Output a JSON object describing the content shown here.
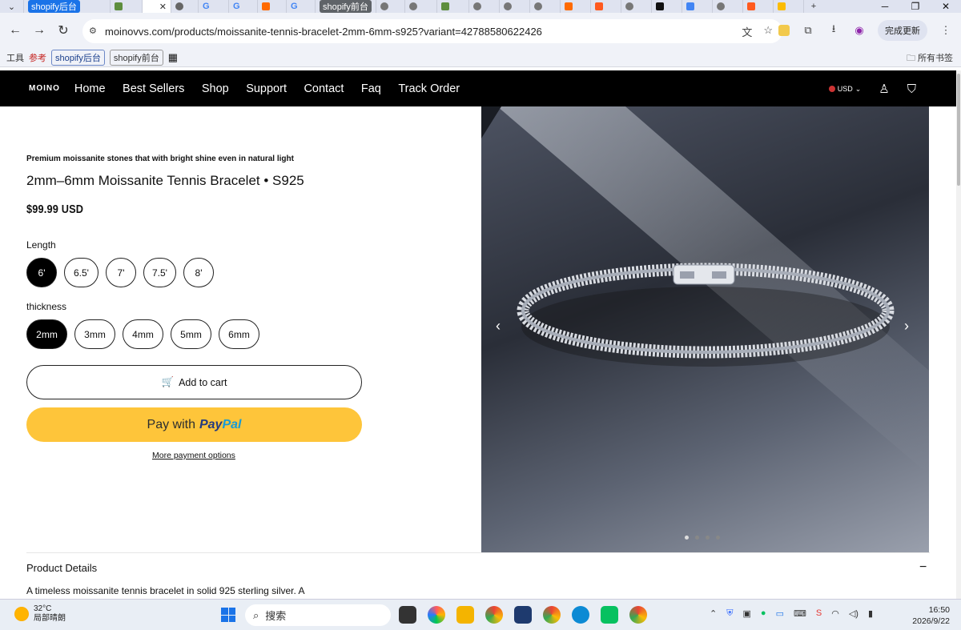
{
  "browser": {
    "tabs": [
      {
        "label": "",
        "kind": "dropdown"
      },
      {
        "label": "shopify后台",
        "kind": "pill"
      },
      {
        "label": "S",
        "kind": "fav"
      },
      {
        "label": "",
        "kind": "active"
      },
      {
        "label": "G",
        "kind": "fav"
      },
      {
        "label": "G",
        "kind": "fav"
      },
      {
        "label": "",
        "kind": "fav"
      },
      {
        "label": "G",
        "kind": "fav"
      },
      {
        "label": "shopify前台",
        "kind": "pill2"
      }
    ],
    "new_tab": "+",
    "url": "moinovvs.com/products/moissanite-tennis-bracelet-2mm-6mm-s925?variant=42788580622426",
    "update_label": "完成更新",
    "bookmarks": {
      "item1": "工具",
      "item2": "参考",
      "item3": "shopify后台",
      "item4": "shopify前台",
      "all": "所有书签"
    }
  },
  "site": {
    "logo": "MOINO",
    "nav": [
      "Home",
      "Best Sellers",
      "Shop",
      "Support",
      "Contact",
      "Faq",
      "Track Order"
    ],
    "currency": "USD"
  },
  "product": {
    "tagline": "Premium moissanite stones that with bright shine even in natural light",
    "title": "2mm–6mm Moissanite Tennis Bracelet • S925",
    "price": "$99.99 USD",
    "length_label": "Length",
    "lengths": [
      "6'",
      "6.5'",
      "7'",
      "7.5'",
      "8'"
    ],
    "length_selected": "6'",
    "thickness_label": "thickness",
    "thicknesses": [
      "2mm",
      "3mm",
      "4mm",
      "5mm",
      "6mm"
    ],
    "thickness_selected": "2mm",
    "add_to_cart": "Add to cart",
    "paypal_prefix": "Pay with",
    "paypal_brand_1": "Pay",
    "paypal_brand_2": "Pal",
    "more_payment": "More payment options",
    "details_heading": "Product Details",
    "details_text": "A timeless moissanite tennis bracelet in solid 925 sterling silver. A",
    "gallery_dots": 4,
    "gallery_active": 0
  },
  "taskbar": {
    "temp": "32°C",
    "weather": "局部晴朗",
    "search": "搜索",
    "time": "16:50",
    "date": "2026/9/22"
  }
}
